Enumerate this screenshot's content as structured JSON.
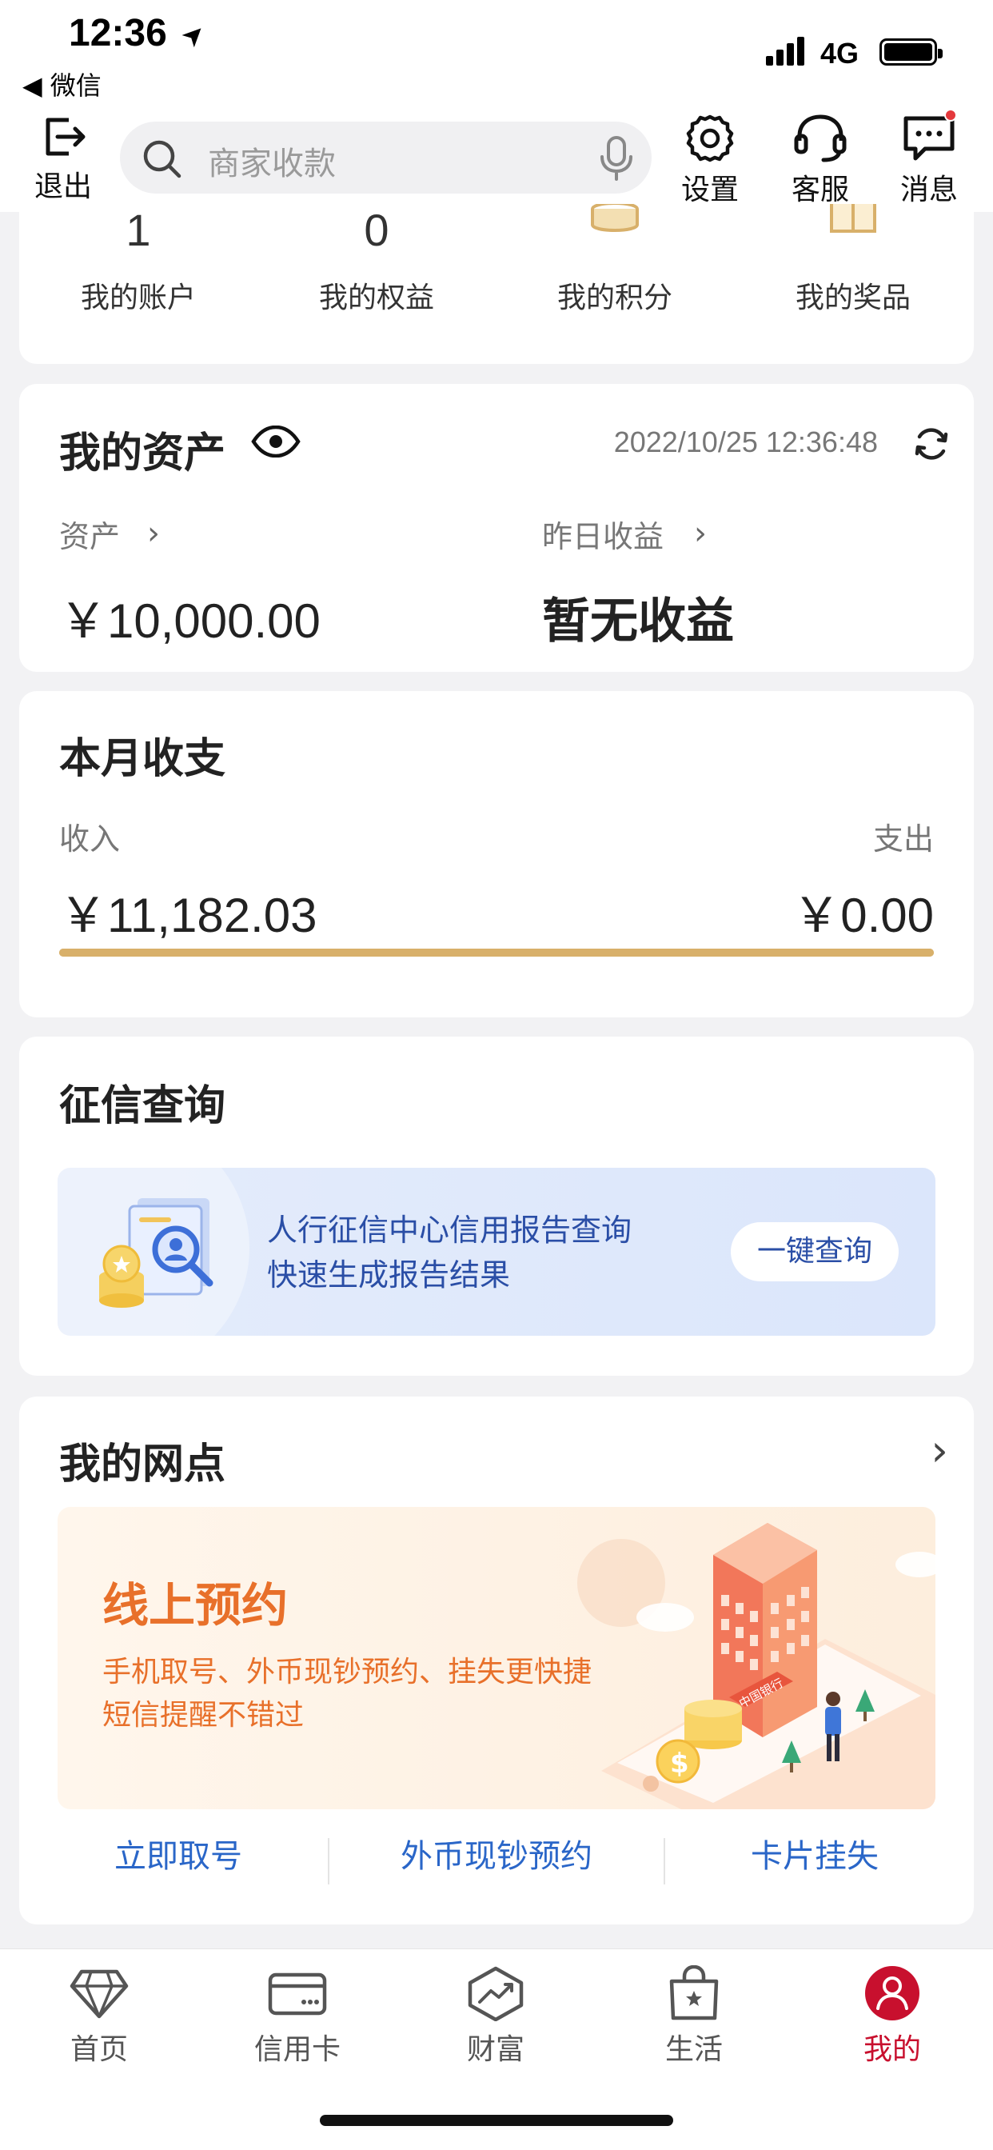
{
  "status_bar": {
    "time": "12:36",
    "location_glyph": "➤",
    "back_app": "◀ 微信",
    "network": "4G"
  },
  "header": {
    "exit_label": "退出",
    "search_placeholder": "商家收款",
    "settings_label": "设置",
    "service_label": "客服",
    "messages_label": "消息"
  },
  "quick_items": [
    {
      "top": "1",
      "label": "我的账户"
    },
    {
      "top": "0",
      "label": "我的权益"
    },
    {
      "top": "",
      "label": "我的积分"
    },
    {
      "top": "",
      "label": "我的奖品"
    }
  ],
  "assets": {
    "title": "我的资产",
    "timestamp": "2022/10/25 12:36:48",
    "assets_label": "资产",
    "assets_value": "￥10,000.00",
    "yesterday_label": "昨日收益",
    "yesterday_value": "暂无收益"
  },
  "monthly": {
    "title": "本月收支",
    "income_label": "收入",
    "income_value": "￥11,182.03",
    "expense_label": "支出",
    "expense_value": "￥0.00",
    "income_ratio": 1.0
  },
  "credit": {
    "title": "征信查询",
    "line1": "人行征信中心信用报告查询",
    "line2": "快速生成报告结果",
    "button": "一键查询"
  },
  "branch": {
    "title": "我的网点",
    "banner_title": "线上预约",
    "banner_line1": "手机取号、外币现钞预约、挂失更快捷",
    "banner_line2": "短信提醒不错过",
    "bank_sign": "中国银行",
    "links": [
      "立即取号",
      "外币现钞预约",
      "卡片挂失"
    ]
  },
  "tabbar": [
    {
      "label": "首页",
      "icon": "diamond-icon"
    },
    {
      "label": "信用卡",
      "icon": "credit-card-icon"
    },
    {
      "label": "财富",
      "icon": "chart-icon"
    },
    {
      "label": "生活",
      "icon": "shopping-bag-icon"
    },
    {
      "label": "我的",
      "icon": "user-icon"
    }
  ],
  "colors": {
    "accent_red": "#c8102e",
    "gold": "#d8b06a",
    "link_blue": "#2a66c8",
    "orange": "#e8702a"
  }
}
